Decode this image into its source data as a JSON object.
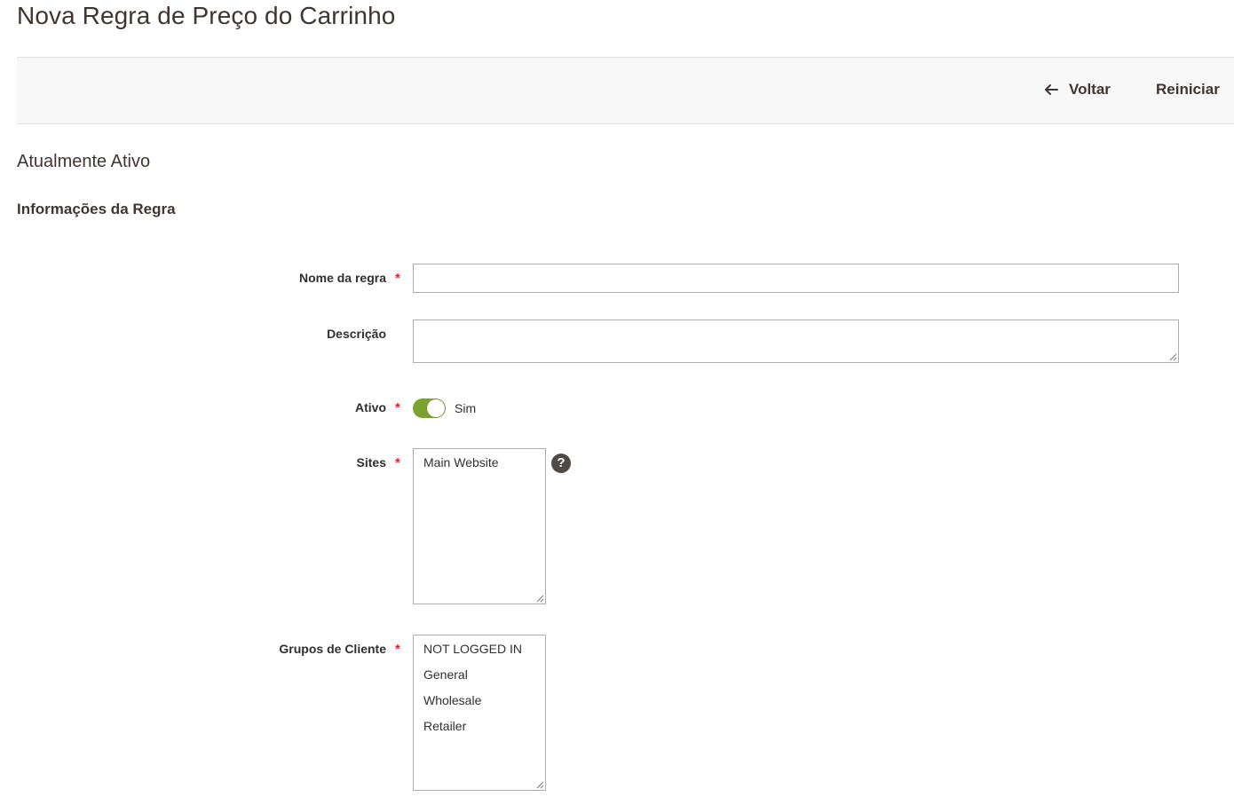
{
  "page": {
    "title": "Nova Regra de Preço do Carrinho"
  },
  "actions": {
    "back_label": "Voltar",
    "reset_label": "Reiniciar"
  },
  "status": {
    "text": "Atualmente Ativo"
  },
  "section": {
    "title": "Informações da Regra"
  },
  "form": {
    "rule_name": {
      "label": "Nome da regra",
      "required": "*",
      "value": ""
    },
    "description": {
      "label": "Descrição",
      "value": ""
    },
    "active": {
      "label": "Ativo",
      "required": "*",
      "state_text": "Sim",
      "on": true,
      "color": "#79a22e"
    },
    "sites": {
      "label": "Sites",
      "required": "*",
      "options": [
        "Main Website"
      ],
      "help_glyph": "?"
    },
    "customer_groups": {
      "label": "Grupos de Cliente",
      "required": "*",
      "options": [
        "NOT LOGGED IN",
        "General",
        "Wholesale",
        "Retailer"
      ]
    }
  },
  "icons": {
    "back": "arrow-left-icon",
    "help": "question-circle-icon"
  },
  "colors": {
    "accent": "#79a22e",
    "required": "#e22626",
    "title": "#41362f"
  }
}
